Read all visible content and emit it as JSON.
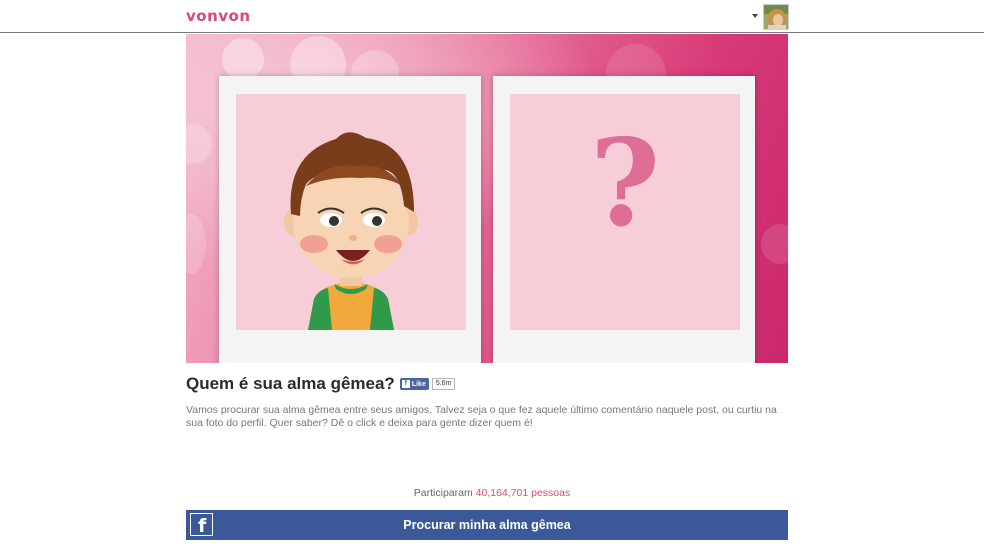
{
  "header": {
    "logo_text": "vonvon",
    "brand_color": "#d9477d"
  },
  "account": {
    "menu_icon": "caret-down-icon",
    "avatar": "user-avatar"
  },
  "hero": {
    "left_card": "boy-cartoon-illustration",
    "right_card": {
      "symbol": "?",
      "symbol_color": "#df6e97"
    }
  },
  "quiz": {
    "title": "Quem é sua alma gêmea?",
    "like_label": "Like",
    "like_count": "5.6m",
    "description": "Vamos procurar sua alma gêmea entre seus amigos. Talvez seja o que fez aquele último comentário naquele post, ou curtiu na sua foto do perfil. Quer saber? Dê o click e deixa para gente dizer quem é!",
    "participants_prefix": "Participaram",
    "participants_count": "40,164,701 pessoas"
  },
  "cta": {
    "label": "Procurar minha alma gêmea",
    "icon": "facebook-icon",
    "color": "#3b5998"
  }
}
